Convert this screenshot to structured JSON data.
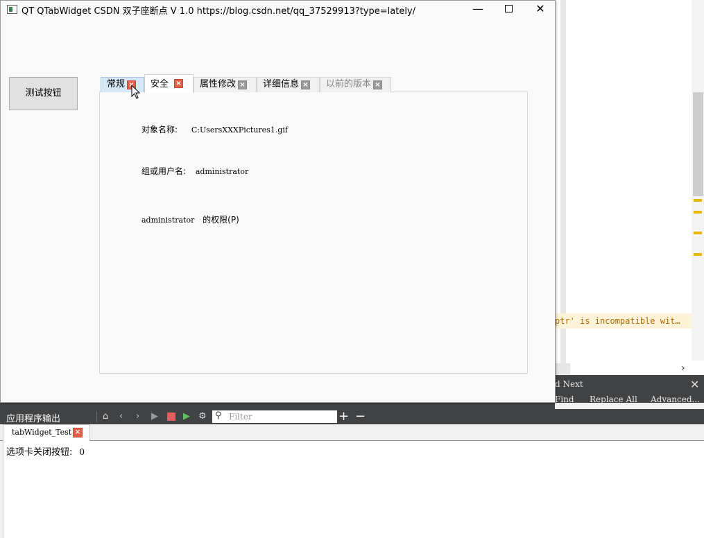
{
  "app": {
    "title": "QT QTabWidget  CSDN 双子座断点 V 1.0 https://blog.csdn.net/qq_37529913?type=lately/",
    "min_glyph": "—",
    "close_glyph": "✕",
    "test_button": "测试按钮"
  },
  "tabs": [
    {
      "label": "常规",
      "close": "red",
      "active": false,
      "hover": true
    },
    {
      "label": "安全",
      "close": "red",
      "active": true,
      "hover": false
    },
    {
      "label": "属性修改",
      "close": "gray",
      "active": false,
      "hover": false
    },
    {
      "label": "详细信息",
      "close": "gray",
      "active": false,
      "hover": false
    },
    {
      "label": "以前的版本",
      "close": "gray",
      "active": false,
      "hover": false,
      "disabled": true
    }
  ],
  "pane": {
    "object_label": "对象名称:",
    "object_value": "C:UsersXXXPictures1.gif",
    "group_label": "组或用户名:",
    "group_value": "administrator",
    "perm_user": "administrator",
    "perm_label": "的权限(P)"
  },
  "ide": {
    "warning_text": "ptr' is incompatible wit…",
    "find_next": "d Next",
    "find_find": "Find",
    "replace_all": "Replace All",
    "advanced": "Advanced..."
  },
  "output": {
    "title": "应用程序输出",
    "filter_placeholder": "Filter",
    "tab_label": "tabWidget_Test",
    "line_label": "选项卡关闭按钮:",
    "line_value": "0"
  },
  "colors": {
    "close_red": "#e0624a",
    "close_gray": "#9a9a9a",
    "toolbar_dark": "#404244",
    "marker_yellow": "#e8b800"
  }
}
